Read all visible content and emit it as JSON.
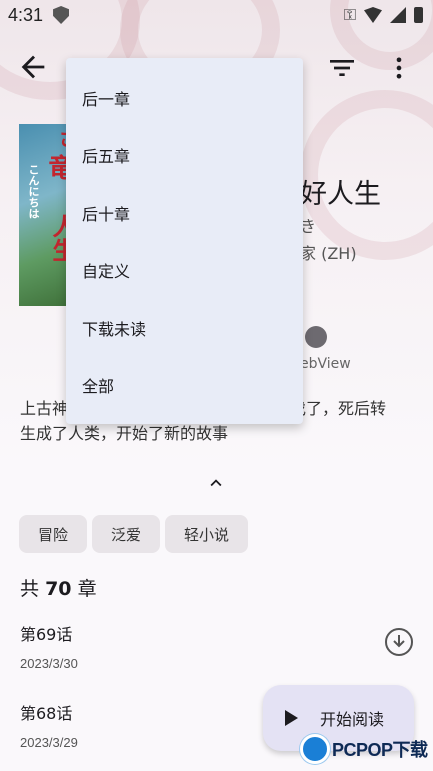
{
  "status_bar": {
    "time": "4:31"
  },
  "manga": {
    "title_fragment": "好人生",
    "author_fragment": "き",
    "source_fragment": "家 (ZH)",
    "webview_label_fragment": "ebView",
    "description_line1_start": "上古神",
    "description_line1_end": "伐了，死后转",
    "description_line2": "生成了人类，开始了新的故事",
    "cover_text": [
      "さ",
      "竜",
      "こんにちは",
      "人生"
    ],
    "tags": [
      "冒险",
      "泛爱",
      "轻小说"
    ]
  },
  "chapters": {
    "count_prefix": "共",
    "count": "70",
    "count_suffix": "章",
    "items": [
      {
        "title": "第69话",
        "date": "2023/3/30"
      },
      {
        "title": "第68话",
        "date": "2023/3/29"
      }
    ]
  },
  "fab": {
    "label": "开始阅读"
  },
  "download_menu": {
    "items": [
      "后一章",
      "后五章",
      "后十章",
      "自定义",
      "下载未读",
      "全部"
    ]
  },
  "watermark": {
    "text": "PCPOP下载"
  },
  "icons": {
    "back": "arrow-back-icon",
    "filter": "filter-icon",
    "more": "more-vert-icon",
    "webview": "globe-icon",
    "collapse": "chevron-up-icon",
    "download": "download-circle-icon",
    "play": "play-icon"
  },
  "colors": {
    "menu_bg": "#e8ecf7",
    "fab_bg": "#e4e2f4",
    "tag_bg": "#e8e4e8"
  }
}
